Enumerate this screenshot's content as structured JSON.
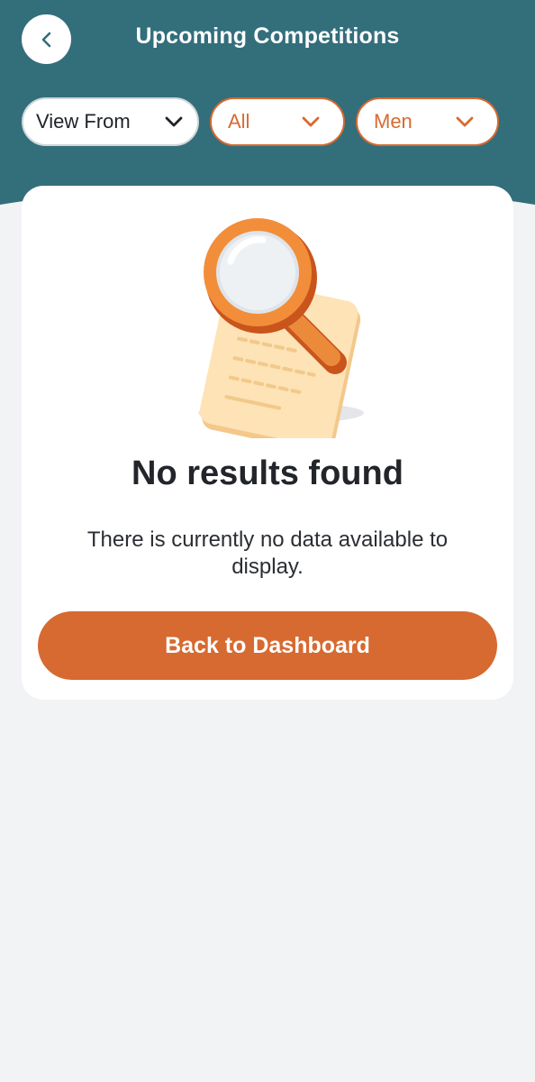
{
  "header": {
    "title": "Upcoming Competitions",
    "back_icon": "chevron-left-icon",
    "background_color": "#336e7b"
  },
  "filters": {
    "view_from": {
      "label": "View From",
      "icon": "chevron-down-icon"
    },
    "category": {
      "label": "All",
      "icon": "chevron-down-icon"
    },
    "gender": {
      "label": "Men",
      "icon": "chevron-down-icon"
    },
    "accent_color": "#d76a30"
  },
  "empty_state": {
    "illustration": "magnifier-over-document-icon",
    "title": "No results found",
    "description": "There is currently no data available to display.",
    "button_label": "Back to Dashboard",
    "button_color": "#d76a30"
  }
}
